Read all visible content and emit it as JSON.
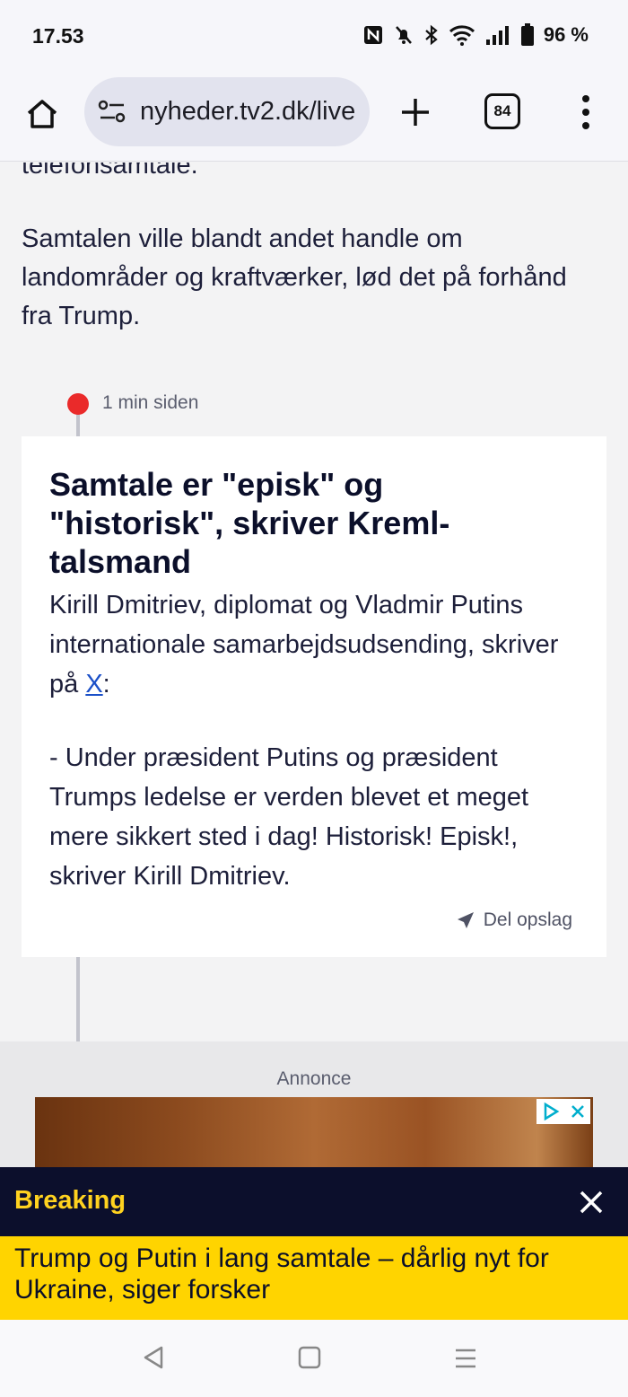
{
  "status_bar": {
    "time": "17.53",
    "battery": "96 %"
  },
  "browser": {
    "url": "nyheder.tv2.dk/live",
    "tab_count": "84"
  },
  "article": {
    "prev_tail": "telefonsamtale.",
    "prev_paragraph": "Samtalen ville blandt andet handle om landområder og kraftværker, lød det på forhånd fra Trump."
  },
  "post": {
    "time_ago": "1 min siden",
    "title": "Samtale er \"episk\" og \"historisk\", skriver Kreml-talsmand",
    "body_intro": "Kirill Dmitriev, diplomat og Vladmir Putins internationale samarbejdsudsending, skriver på ",
    "link_label": "X",
    "body_colon": ":",
    "quote": "- Under præsident Putins og præsident Trumps ledelse er verden blevet et meget mere sikkert sted i dag! Historisk! Episk!, skriver Kirill Dmitriev.",
    "share_label": "Del opslag"
  },
  "ad": {
    "label": "Annonce"
  },
  "breaking": {
    "label": "Breaking",
    "headline": "Trump og Putin i lang samtale – dårlig nyt for Ukraine, siger forsker"
  },
  "colors": {
    "breaking_bar": "#0c0f2c",
    "breaking_label": "#ffd21f",
    "breaking_headline_bg": "#ffd400",
    "live_dot": "#ea2a2a",
    "link": "#1b50c8"
  }
}
